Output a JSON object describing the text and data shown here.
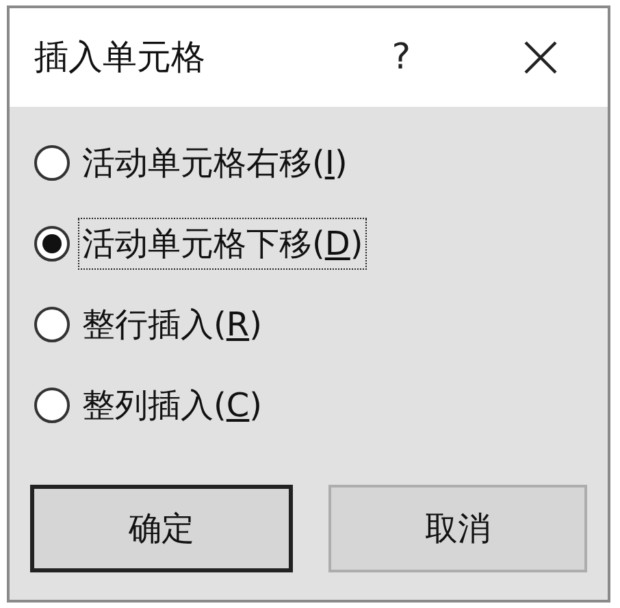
{
  "window": {
    "title": "插入单元格",
    "help": "?"
  },
  "options": [
    {
      "label": "活动单元格右移(I)",
      "selected": false
    },
    {
      "label": "活动单元格下移(D)",
      "selected": true
    },
    {
      "label": "整行插入(R)",
      "selected": false
    },
    {
      "label": "整列插入(C)",
      "selected": false
    }
  ],
  "buttons": [
    {
      "label": "确定",
      "default": true
    },
    {
      "label": "取消",
      "default": false
    }
  ]
}
